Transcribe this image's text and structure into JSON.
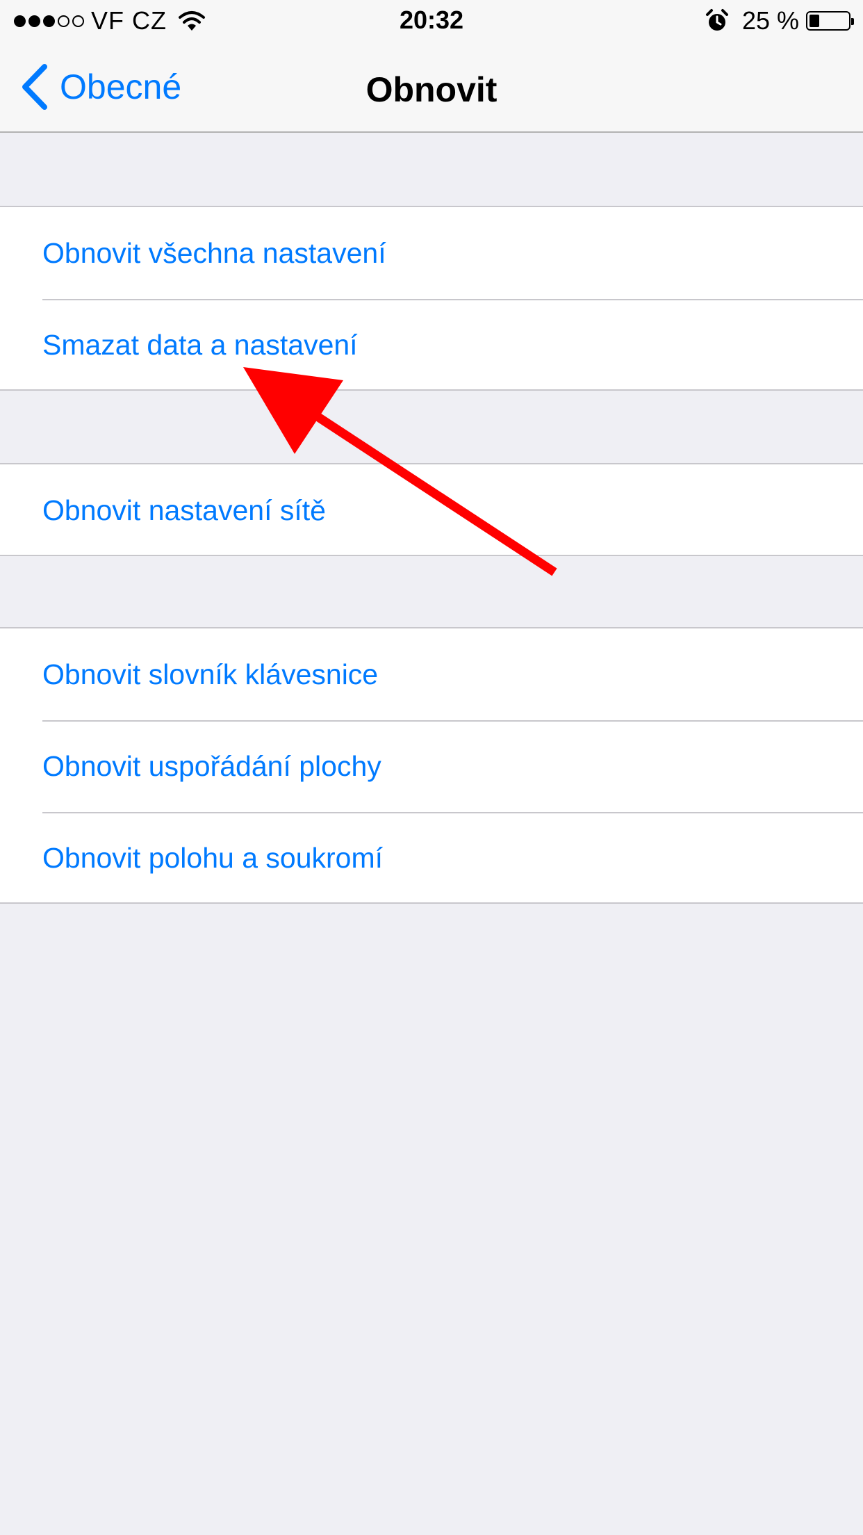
{
  "status_bar": {
    "signal_filled": 3,
    "signal_total": 5,
    "carrier": "VF CZ",
    "time": "20:32",
    "battery_percent": "25 %",
    "battery_level": 0.25,
    "icons": [
      "signal-dots-icon",
      "wifi-icon",
      "alarm-icon",
      "battery-icon"
    ]
  },
  "nav": {
    "back_label": "Obecné",
    "title": "Obnovit",
    "back_icon": "chevron-left-icon"
  },
  "groups": [
    {
      "items": [
        {
          "label": "Obnovit všechna nastavení"
        },
        {
          "label": "Smazat data a nastavení"
        }
      ]
    },
    {
      "items": [
        {
          "label": "Obnovit nastavení sítě"
        }
      ]
    },
    {
      "items": [
        {
          "label": "Obnovit slovník klávesnice"
        },
        {
          "label": "Obnovit uspořádání plochy"
        },
        {
          "label": "Obnovit polohu a soukromí"
        }
      ]
    }
  ],
  "colors": {
    "accent": "#007aff",
    "background": "#efeff4",
    "separator": "#c8c7cc",
    "annotation_arrow": "#ff0000"
  }
}
